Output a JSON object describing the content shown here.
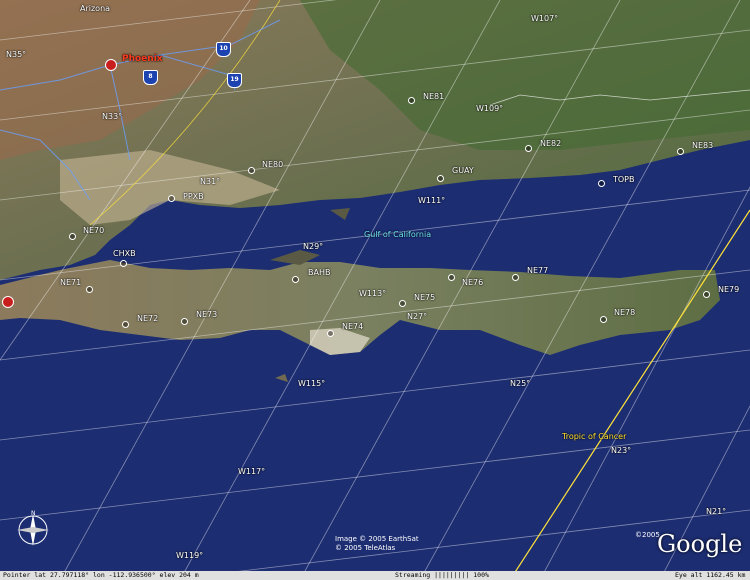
{
  "map": {
    "labels": {
      "arizona": "Arizona",
      "phoenix": "Phoenix",
      "gulf": "Gulf of California",
      "tropic": "Tropic of Cancer"
    },
    "interstates": {
      "i10": "10",
      "i8": "8",
      "i19": "19"
    },
    "places": [
      {
        "code": "NE81"
      },
      {
        "code": "NE82"
      },
      {
        "code": "NE83"
      },
      {
        "code": "NE80"
      },
      {
        "code": "GUAY"
      },
      {
        "code": "TOPB"
      },
      {
        "code": "PPXB"
      },
      {
        "code": "NE70"
      },
      {
        "code": "CHXB"
      },
      {
        "code": "NE71"
      },
      {
        "code": "NE72"
      },
      {
        "code": "NE73"
      },
      {
        "code": "BAHB"
      },
      {
        "code": "NE74"
      },
      {
        "code": "NE75"
      },
      {
        "code": "NE76"
      },
      {
        "code": "NE77"
      },
      {
        "code": "NE78"
      },
      {
        "code": "NE79"
      }
    ],
    "grid_labels": {
      "n35": "N35°",
      "n33": "N33°",
      "n31": "N31°",
      "n29": "N29°",
      "n27": "N27°",
      "n25": "N25°",
      "n23": "N23°",
      "n21": "N21°",
      "w107": "W107°",
      "w109": "W109°",
      "w111": "W111°",
      "w113": "W113°",
      "w115": "W115°",
      "w117": "W117°",
      "w119": "W119°"
    }
  },
  "credits": {
    "line1": "Image © 2005 EarthSat",
    "line2": "© 2005 TeleAtlas"
  },
  "logo": {
    "copyright": "©2005",
    "text": "Google"
  },
  "status": {
    "pointer": "Pointer  lat   27.797118°   lon -112.936500°  elev  204 m",
    "streaming": "Streaming ||||||||| 100%",
    "eye": "Eye  alt  1162.45 km"
  }
}
